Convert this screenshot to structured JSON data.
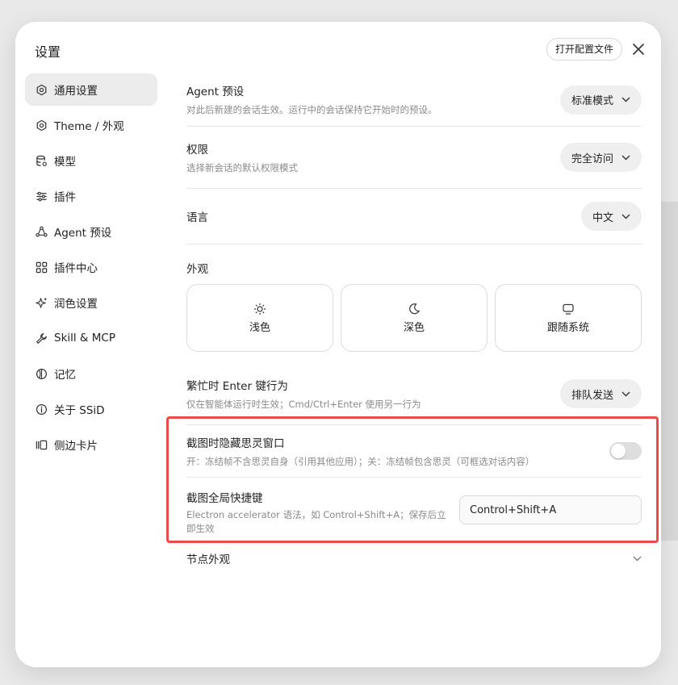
{
  "modal": {
    "title": "设置",
    "open_config_label": "打开配置文件"
  },
  "sidebar": {
    "items": [
      {
        "label": "通用设置",
        "icon": "gear-icon",
        "active": true
      },
      {
        "label": "Theme / 外观",
        "icon": "theme-icon"
      },
      {
        "label": "模型",
        "icon": "database-icon"
      },
      {
        "label": "插件",
        "icon": "sliders-icon"
      },
      {
        "label": "Agent 预设",
        "icon": "agent-icon"
      },
      {
        "label": "插件中心",
        "icon": "grid-icon"
      },
      {
        "label": "润色设置",
        "icon": "sparkle-icon"
      },
      {
        "label": "Skill & MCP",
        "icon": "wrench-icon"
      },
      {
        "label": "记忆",
        "icon": "memory-icon"
      },
      {
        "label": "关于 SSiD",
        "icon": "info-icon"
      },
      {
        "label": "侧边卡片",
        "icon": "cards-icon"
      }
    ]
  },
  "settings": {
    "agent_preset": {
      "title": "Agent 预设",
      "desc": "对此后新建的会话生效。运行中的会话保持它开始时的预设。",
      "value": "标准模式"
    },
    "permission": {
      "title": "权限",
      "desc": "选择新会话的默认权限模式",
      "value": "完全访问"
    },
    "language": {
      "title": "语言",
      "value": "中文"
    },
    "appearance": {
      "title": "外观",
      "options": [
        {
          "label": "浅色",
          "icon": "sun-icon"
        },
        {
          "label": "深色",
          "icon": "moon-icon"
        },
        {
          "label": "跟随系统",
          "icon": "monitor-icon"
        }
      ]
    },
    "busy_enter": {
      "title": "繁忙时 Enter 键行为",
      "desc": "仅在智能体运行时生效；Cmd/Ctrl+Enter 使用另一行为",
      "value": "排队发送"
    },
    "hide_window": {
      "title": "截图时隐藏思灵窗口",
      "desc": "开：冻结帧不含思灵自身（引用其他应用）；关：冻结帧包含思灵（可框选对话内容）",
      "enabled": false
    },
    "shortcut": {
      "title": "截图全局快捷键",
      "desc": "Electron accelerator 语法，如 Control+Shift+A；保存后立即生效",
      "value": "Control+Shift+A"
    },
    "node_appearance": {
      "title": "节点外观"
    }
  },
  "colors": {
    "highlight": "#ef4a4a",
    "active_bg": "#ececec"
  }
}
